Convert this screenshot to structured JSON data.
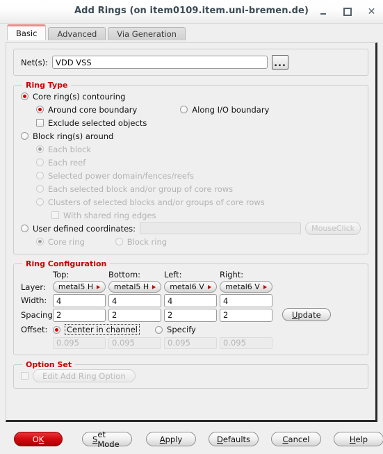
{
  "window": {
    "title": "Add Rings (on item0109.item.uni-bremen.de)",
    "minimize_label": "minimize",
    "maximize_label": "maximize",
    "close_label": "close"
  },
  "tabs": [
    {
      "label": "Basic",
      "active": true
    },
    {
      "label": "Advanced",
      "active": false
    },
    {
      "label": "Via Generation",
      "active": false
    }
  ],
  "nets": {
    "label": "Net(s):",
    "value": "VDD VSS",
    "placeholder": "",
    "browse_label": "..."
  },
  "ring_type": {
    "legend": "Ring Type",
    "core_contouring": "Core ring(s) contouring",
    "around_core_boundary": "Around core boundary",
    "along_io_boundary": "Along I/O boundary",
    "exclude_selected_objects": "Exclude selected objects",
    "block_rings_around": "Block ring(s) around",
    "each_block": "Each block",
    "each_reef": "Each reef",
    "selected_power_domain": "Selected power domain/fences/reefs",
    "each_selected_block": "Each selected block and/or group of core rows",
    "clusters_of_selected": "Clusters of selected blocks and/or groups of core rows",
    "with_shared_ring_edges": "With shared ring edges",
    "user_defined_coordinates": "User defined coordinates:",
    "user_defined_value": "",
    "mouse_click_label": "MouseClick",
    "core_ring": "Core ring",
    "block_ring": "Block ring"
  },
  "ring_config": {
    "legend": "Ring Configuration",
    "columns": [
      "Top:",
      "Bottom:",
      "Left:",
      "Right:"
    ],
    "layer_label": "Layer:",
    "layers": [
      "metal5 H",
      "metal5 H",
      "metal6 V",
      "metal6 V"
    ],
    "width_label": "Width:",
    "widths": [
      "4",
      "4",
      "4",
      "4"
    ],
    "spacing_label": "Spacing:",
    "spacings": [
      "2",
      "2",
      "2",
      "2"
    ],
    "offset_label": "Offset:",
    "center_in_channel": "Center in channel",
    "specify": "Specify",
    "offsets": [
      "0.095",
      "0.095",
      "0.095",
      "0.095"
    ],
    "update_label_pre": "U",
    "update_label_post": "pdate"
  },
  "option_set": {
    "legend": "Option Set",
    "edit_button": "Edit Add Ring Option"
  },
  "footer": {
    "ok": {
      "pre": "O",
      "mn": "K",
      "post": ""
    },
    "set_mode": {
      "pre": "",
      "mn": "S",
      "post": "et Mode"
    },
    "apply": {
      "pre": "",
      "mn": "A",
      "post": "pply"
    },
    "defaults": {
      "pre": "",
      "mn": "D",
      "post": "efaults"
    },
    "cancel": {
      "pre": "",
      "mn": "C",
      "post": "ancel"
    },
    "help": {
      "pre": "",
      "mn": "H",
      "post": "elp"
    }
  },
  "colors": {
    "accent_red": "#cc0000",
    "ok_red": "#d2090f",
    "tab_active_top": "#ef8b8b",
    "background": "#efefef",
    "title_text": "#3b4a54"
  }
}
